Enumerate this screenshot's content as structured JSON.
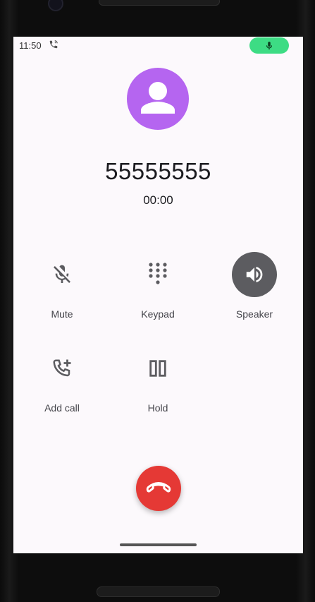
{
  "status_bar": {
    "time": "11:50",
    "accent_color": "#3ddc84"
  },
  "call": {
    "number": "55555555",
    "timer": "00:00",
    "avatar_color": "#b565f0"
  },
  "controls": [
    {
      "label": "Mute",
      "icon": "mic-off-icon",
      "active": false
    },
    {
      "label": "Keypad",
      "icon": "dialpad-icon",
      "active": false
    },
    {
      "label": "Speaker",
      "icon": "speaker-icon",
      "active": true
    },
    {
      "label": "Add call",
      "icon": "add-call-icon",
      "active": false
    },
    {
      "label": "Hold",
      "icon": "pause-icon",
      "active": false
    }
  ],
  "end_call": {
    "icon": "end-call-icon",
    "color": "#e53935"
  }
}
